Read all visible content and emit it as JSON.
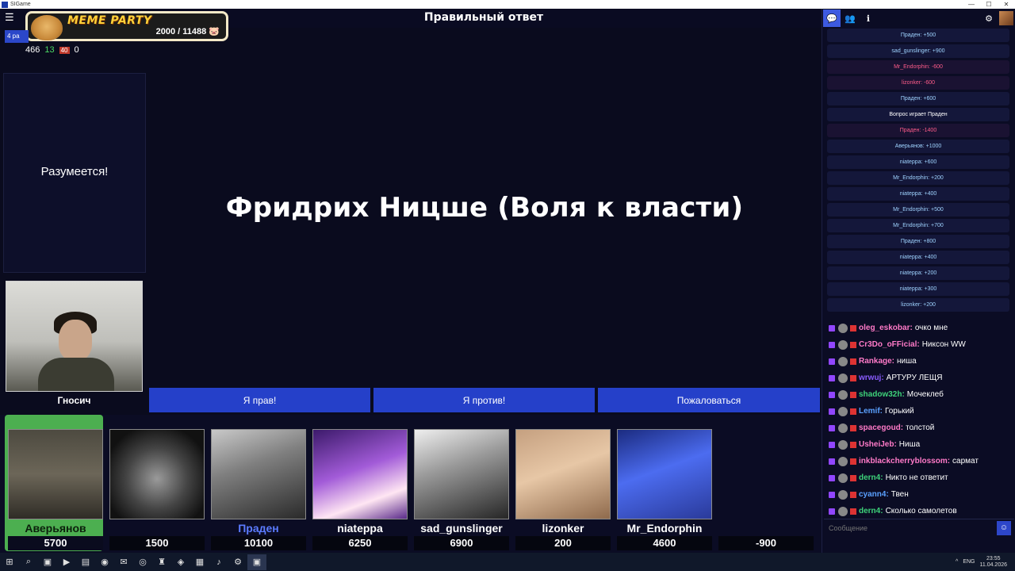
{
  "window": {
    "title": "SIGame",
    "controls": [
      "—",
      "☐",
      "✕"
    ]
  },
  "header": {
    "round_title": "Правильный ответ"
  },
  "overlay": {
    "title": "MEME PARTY",
    "counter": "2000 / 11488"
  },
  "stream_stats": {
    "tag": "4 ра",
    "viewers": "466",
    "v1": "13",
    "v2": "40",
    "v3": "0"
  },
  "left_panel": {
    "message": "Разумеется!"
  },
  "host": {
    "name": "Гносич"
  },
  "answer": {
    "text": "Фридрих Ницше (Воля к власти)"
  },
  "actions": {
    "right": "Я прав!",
    "against": "Я против!",
    "complain": "Пожаловаться"
  },
  "players": [
    {
      "name": "Аверьянов",
      "score": "5700"
    },
    {
      "name": "",
      "score": "1500"
    },
    {
      "name": "Праден",
      "score": "10100"
    },
    {
      "name": "niateppa",
      "score": "6250"
    },
    {
      "name": "sad_gunslinger",
      "score": "6900"
    },
    {
      "name": "lizonker",
      "score": "200"
    },
    {
      "name": "Mr_Endorphin",
      "score": "4600"
    },
    {
      "name": "",
      "score": "-900"
    }
  ],
  "log": [
    {
      "text": "Праден: +500",
      "kind": "plus"
    },
    {
      "text": "sad_gunslinger: +900",
      "kind": "plus"
    },
    {
      "text": "Mr_Endorphin: -600",
      "kind": "neg"
    },
    {
      "text": "lizonker: -600",
      "kind": "neg"
    },
    {
      "text": "Праден: +600",
      "kind": "plus"
    },
    {
      "text": "Вопрос играет Праден",
      "kind": "info"
    },
    {
      "text": "Праден: -1400",
      "kind": "neg"
    },
    {
      "text": "Аверьянов: +1000",
      "kind": "plus"
    },
    {
      "text": "niateppa: +600",
      "kind": "plus"
    },
    {
      "text": "Mr_Endorphin: +200",
      "kind": "plus"
    },
    {
      "text": "niateppa: +400",
      "kind": "plus"
    },
    {
      "text": "Mr_Endorphin: +500",
      "kind": "plus"
    },
    {
      "text": "Mr_Endorphin: +700",
      "kind": "plus"
    },
    {
      "text": "Праден: +800",
      "kind": "plus"
    },
    {
      "text": "niateppa: +400",
      "kind": "plus"
    },
    {
      "text": "niateppa: +200",
      "kind": "plus"
    },
    {
      "text": "niateppa: +300",
      "kind": "plus"
    },
    {
      "text": "lizonker: +200",
      "kind": "plus"
    }
  ],
  "chat": [
    {
      "user": "oleg_eskobar:",
      "text": "очко мне",
      "color": "#ff7ac8"
    },
    {
      "user": "Cr3Do_oFFicial:",
      "text": "Никсон WW",
      "color": "#ff7ac8"
    },
    {
      "user": "Rankage:",
      "text": "ниша",
      "color": "#ff7ac8"
    },
    {
      "user": "wrwuj:",
      "text": "АРТУРУ ЛЕЩЯ",
      "color": "#8a5cff"
    },
    {
      "user": "shadow32h:",
      "text": "Мочеклеб",
      "color": "#3ed37a"
    },
    {
      "user": "Lemif:",
      "text": "Горький",
      "color": "#5aa0ff"
    },
    {
      "user": "spacegoud:",
      "text": "толстой",
      "color": "#ff7ac8"
    },
    {
      "user": "UsheiJeb:",
      "text": "Ниша",
      "color": "#ff7ac8"
    },
    {
      "user": "inkblackcherryblossom:",
      "text": "сармат",
      "color": "#ff7ac8"
    },
    {
      "user": "dern4:",
      "text": "Никто не ответит",
      "color": "#3ed37a"
    },
    {
      "user": "cyann4:",
      "text": "Твен",
      "color": "#5aa0ff"
    },
    {
      "user": "dern4:",
      "text": "Сколько самолетов",
      "color": "#3ed37a"
    }
  ],
  "message_input": {
    "placeholder": "Сообщение"
  },
  "taskbar": {
    "lang": "ENG",
    "time": "23:55",
    "date": "11.04.2026"
  }
}
